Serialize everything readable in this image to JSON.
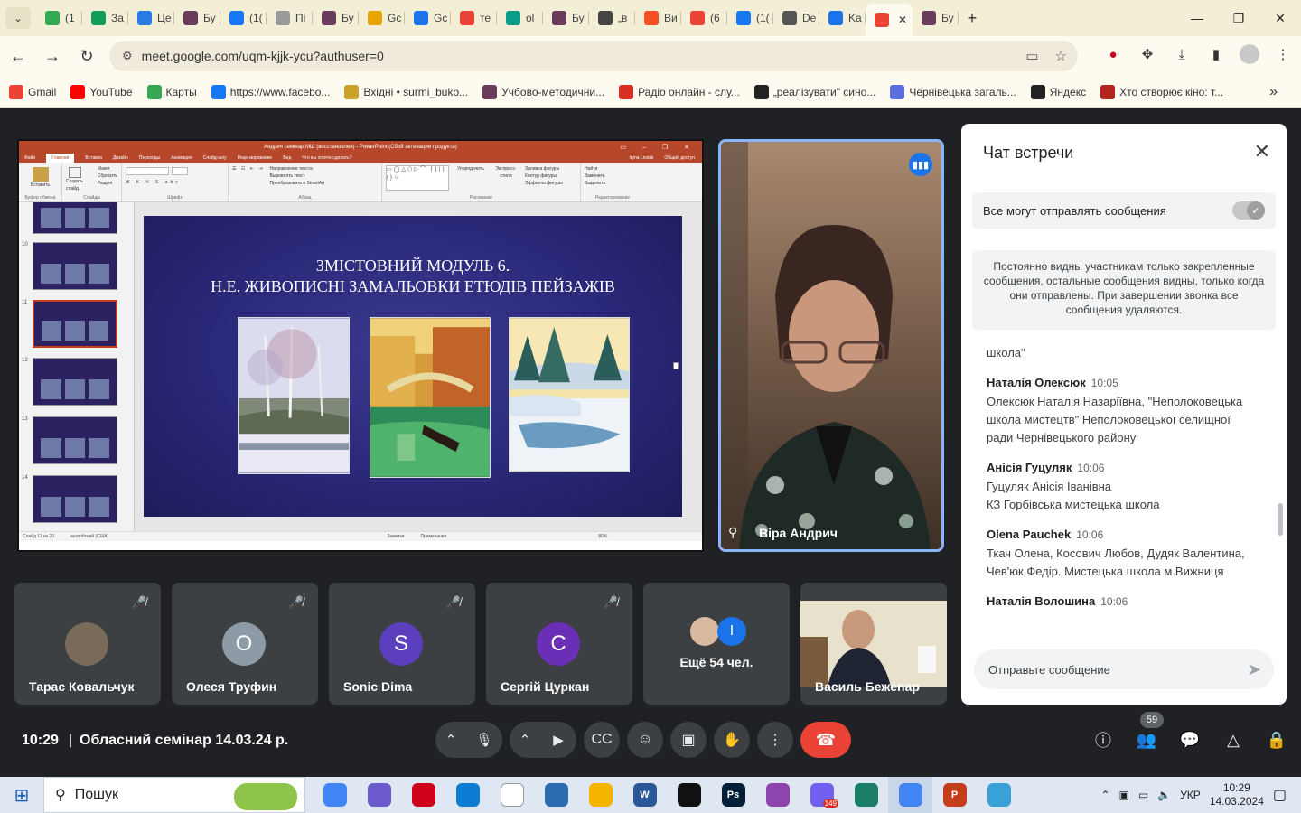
{
  "browser": {
    "tabs": [
      {
        "icon": "classroom-icon",
        "label": "(1",
        "color": "#34a853"
      },
      {
        "icon": "sheets-plus-icon",
        "label": "За",
        "color": "#0f9d58"
      },
      {
        "icon": "k-icon",
        "label": "Це",
        "color": "#2c7be5"
      },
      {
        "icon": "flower-icon",
        "label": "Бу",
        "color": "#6a3b5a"
      },
      {
        "icon": "facebook-icon",
        "label": "(1(",
        "color": "#1877f2"
      },
      {
        "icon": "link-icon",
        "label": "Пі",
        "color": "#999999"
      },
      {
        "icon": "flower-icon",
        "label": "Бу",
        "color": "#6a3b5a"
      },
      {
        "icon": "chart-icon",
        "label": "Gc",
        "color": "#e8a400"
      },
      {
        "icon": "calendar-12-icon",
        "label": "Gc",
        "color": "#1a73e8"
      },
      {
        "icon": "google-icon",
        "label": "те",
        "color": "#ea4335"
      },
      {
        "icon": "ok-icon",
        "label": "ol",
        "color": "#0a9e8a"
      },
      {
        "icon": "flower-icon",
        "label": "Бу",
        "color": "#6a3b5a"
      },
      {
        "icon": "globe-icon",
        "label": "„в",
        "color": "#444444"
      },
      {
        "icon": "microsoft-icon",
        "label": "Ви",
        "color": "#f25022"
      },
      {
        "icon": "gmail-icon",
        "label": "(6",
        "color": "#ea4335"
      },
      {
        "icon": "facebook-icon",
        "label": "(1(",
        "color": "#1877f2"
      },
      {
        "icon": "globe-icon",
        "label": "De",
        "color": "#555555"
      },
      {
        "icon": "calendar-14-icon",
        "label": "Ka",
        "color": "#1a73e8"
      },
      {
        "icon": "meet-recording-icon",
        "label": "",
        "color": "#ea4335",
        "active": true
      },
      {
        "icon": "flower-icon",
        "label": "Бу",
        "color": "#6a3b5a"
      }
    ],
    "url": "meet.google.com/uqm-kjjk-ycu?authuser=0",
    "bookmarks": [
      {
        "icon": "gmail-icon",
        "label": "Gmail",
        "color": "#ea4335"
      },
      {
        "icon": "youtube-icon",
        "label": "YouTube",
        "color": "#ff0000"
      },
      {
        "icon": "maps-icon",
        "label": "Карты",
        "color": "#34a853"
      },
      {
        "icon": "facebook-icon",
        "label": "https://www.facebo...",
        "color": "#1877f2"
      },
      {
        "icon": "folder-icon",
        "label": "Вхідні • surmi_buko...",
        "color": "#c9a227"
      },
      {
        "icon": "flower-icon",
        "label": "Учбово-методични...",
        "color": "#6a3b5a"
      },
      {
        "icon": "radio-icon",
        "label": "Радіо онлайн - слу...",
        "color": "#d93025"
      },
      {
        "icon": "globe-icon",
        "label": "„реалізувати\" сино...",
        "color": "#222222"
      },
      {
        "icon": "shield-icon",
        "label": "Чернівецька загаль...",
        "color": "#5b6ee1"
      },
      {
        "icon": "globe-icon",
        "label": "Яндекс",
        "color": "#222222"
      },
      {
        "icon": "bit-icon",
        "label": "Хто створює кіно: т...",
        "color": "#b3261e"
      }
    ]
  },
  "presentation": {
    "window_title": "Андрич семінар МШ (восстановлен) - PowerPoint (Сбой активации продукта)",
    "ribbon_tabs": [
      "Файл",
      "Главная",
      "Вставка",
      "Дизайн",
      "Переходы",
      "Анимация",
      "Слайд-шоу",
      "Рецензирование",
      "Вид",
      "Что вы хотите сделать?"
    ],
    "ribbon_user": "Iryna Lesiuk",
    "share": "Общий доступ",
    "groups": [
      "Буфер обмена",
      "Слайды",
      "Шрифт",
      "Абзац",
      "Рисование",
      "Редактирование"
    ],
    "buttons": [
      "Вставить",
      "Создать слайд",
      "Макет",
      "Сбросить",
      "Раздел",
      "Направление текста",
      "Выровнять текст",
      "Преобразовать в SmartArt",
      "Упорядочить",
      "Экспресс-стили",
      "Заливка фигуры",
      "Контур фигуры",
      "Эффекты фигуры",
      "Найти",
      "Заменить",
      "Выделить"
    ],
    "thumb_numbers": [
      "10",
      "11",
      "12",
      "13",
      "14"
    ],
    "slide_title_1": "ЗМІСТОВНИЙ МОДУЛЬ 6.",
    "slide_title_2": "Н.Е. ЖИВОПИСНІ ЗАМАЛЬОВКИ ЕТЮДІВ  ПЕЙЗАЖІВ",
    "status_slide": "Слайд 11 из 20",
    "status_lang": "английский (США)",
    "status_notes": "Заметки",
    "status_comments": "Примечания",
    "zoom": "80%"
  },
  "speaker": {
    "name": "Віра Андрич"
  },
  "participants": [
    {
      "name": "Тарас Ковальчук",
      "initial": "",
      "avatar_color": "#7a6a5a",
      "muted": true
    },
    {
      "name": "Олеся Труфин",
      "initial": "О",
      "avatar_color": "#8e9aa6",
      "muted": true
    },
    {
      "name": "Sonic Dima",
      "initial": "S",
      "avatar_color": "#5b3fbf",
      "muted": true
    },
    {
      "name": "Сергій Цуркан",
      "initial": "С",
      "avatar_color": "#6a2fb6",
      "muted": true
    }
  ],
  "overflow": {
    "label": "Ещё 54 чел.",
    "initial": "I"
  },
  "video_tile": {
    "name": "Василь Бежenар"
  },
  "chat": {
    "title": "Чат встречи",
    "toggle_label": "Все могут отправлять сообщения",
    "note": "Постоянно видны участникам только закрепленные сообщения, остальные сообщения видны, только когда они отправлены. При завершении звонка все сообщения удаляются.",
    "cut_text": "школа\"",
    "messages": [
      {
        "author": "Наталія Олексюк",
        "time": "10:05",
        "text": "Олексюк Наталія Назаріївна, \"Неполоковецька школа мистецтв\" Неполоковецької селищної ради Чернівецького району"
      },
      {
        "author": "Анісія Гуцуляк",
        "time": "10:06",
        "text": "Гуцуляк Анісія Іванівна\nКЗ Горбівська мистецька школа"
      },
      {
        "author": "Olena Pauchek",
        "time": "10:06",
        "text": "Ткач Олена, Косович Любов, Дудяк Валентина, Чев'юк Федір. Мистецька школа м.Вижниця"
      },
      {
        "author": "Наталія Волошина",
        "time": "10:06",
        "text": ""
      }
    ],
    "input_placeholder": "Отправьте сообщение"
  },
  "bottom": {
    "time": "10:29",
    "meeting_title": "Обласний семінар 14.03.24 р.",
    "people_count": "59"
  },
  "taskbar": {
    "search_placeholder": "Пошук",
    "apps": [
      {
        "icon": "chrome-icon",
        "color": "#4285f4",
        "label": ""
      },
      {
        "icon": "vpn-icon",
        "color": "#6a5acd",
        "label": ""
      },
      {
        "icon": "opera-icon",
        "color": "#d0021b",
        "label": ""
      },
      {
        "icon": "edge-icon",
        "color": "#0c7bd4",
        "label": ""
      },
      {
        "icon": "file-icon",
        "color": "#ffffff",
        "label": ""
      },
      {
        "icon": "presentation-icon",
        "color": "#2b6cb0",
        "label": ""
      },
      {
        "icon": "file-explorer-icon",
        "color": "#f4b400",
        "label": ""
      },
      {
        "icon": "word-icon",
        "color": "#2b579a",
        "label": "W"
      },
      {
        "icon": "xbox-icon",
        "color": "#111111",
        "label": ""
      },
      {
        "icon": "photoshop-icon",
        "color": "#001e36",
        "label": "Ps"
      },
      {
        "icon": "picasa-icon",
        "color": "#8e44ad",
        "label": ""
      },
      {
        "icon": "viber-icon",
        "color": "#7360f2",
        "label": "",
        "count": "149"
      },
      {
        "icon": "network-icon",
        "color": "#1a7f64",
        "label": ""
      },
      {
        "icon": "chrome-active-icon",
        "color": "#4285f4",
        "label": "",
        "active": true
      },
      {
        "icon": "powerpoint-icon",
        "color": "#c43e1c",
        "label": "P"
      },
      {
        "icon": "paint-icon",
        "color": "#3aa0d8",
        "label": ""
      }
    ],
    "lang": "УКР",
    "clock_time": "10:29",
    "clock_date": "14.03.2024"
  }
}
